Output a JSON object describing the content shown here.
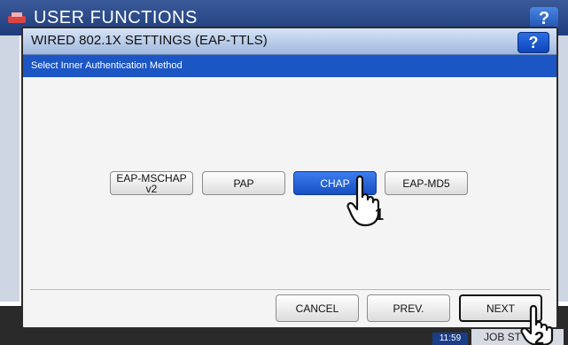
{
  "app": {
    "title": "USER FUNCTIONS",
    "help_label": "?"
  },
  "dialog": {
    "title": "WIRED 802.1X SETTINGS (EAP-TTLS)",
    "help_label": "?",
    "instruction": "Select Inner Authentication Method"
  },
  "options": [
    {
      "label": "EAP-MSCHAP\nv2",
      "selected": false
    },
    {
      "label": "PAP",
      "selected": false
    },
    {
      "label": "CHAP",
      "selected": true
    },
    {
      "label": "EAP-MD5",
      "selected": false
    }
  ],
  "nav": {
    "cancel_label": "CANCEL",
    "prev_label": "PREV.",
    "next_label": "NEXT"
  },
  "status": {
    "time": "11:59",
    "job_status": "JOB ST"
  },
  "callouts": {
    "step1": "1",
    "step2": "2"
  },
  "colors": {
    "accent": "#1b56c4",
    "selected": "#2a6ee6"
  }
}
